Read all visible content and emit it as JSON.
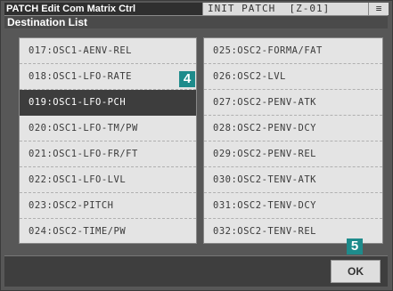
{
  "header": {
    "title": "PATCH Edit Com Matrix Ctrl",
    "patch_name": "INIT PATCH  [Z-01]",
    "menu_glyph": "≡"
  },
  "dialog": {
    "title": "Destination List"
  },
  "destinations_left": [
    "017:OSC1-AENV-REL",
    "018:OSC1-LFO-RATE",
    "019:OSC1-LFO-PCH",
    "020:OSC1-LFO-TM/PW",
    "021:OSC1-LFO-FR/FT",
    "022:OSC1-LFO-LVL",
    "023:OSC2-PITCH",
    "024:OSC2-TIME/PW"
  ],
  "destinations_right": [
    "025:OSC2-FORMA/FAT",
    "026:OSC2-LVL",
    "027:OSC2-PENV-ATK",
    "028:OSC2-PENV-DCY",
    "029:OSC2-PENV-REL",
    "030:OSC2-TENV-ATK",
    "031:OSC2-TENV-DCY",
    "032:OSC2-TENV-REL"
  ],
  "selected_destination": "019:OSC1-LFO-PCH",
  "callouts": {
    "list": "4",
    "ok": "5"
  },
  "footer": {
    "ok_label": "OK"
  },
  "colors": {
    "background": "#575757",
    "selected": "#3d3d3d",
    "callout": "#1e8b8b"
  }
}
